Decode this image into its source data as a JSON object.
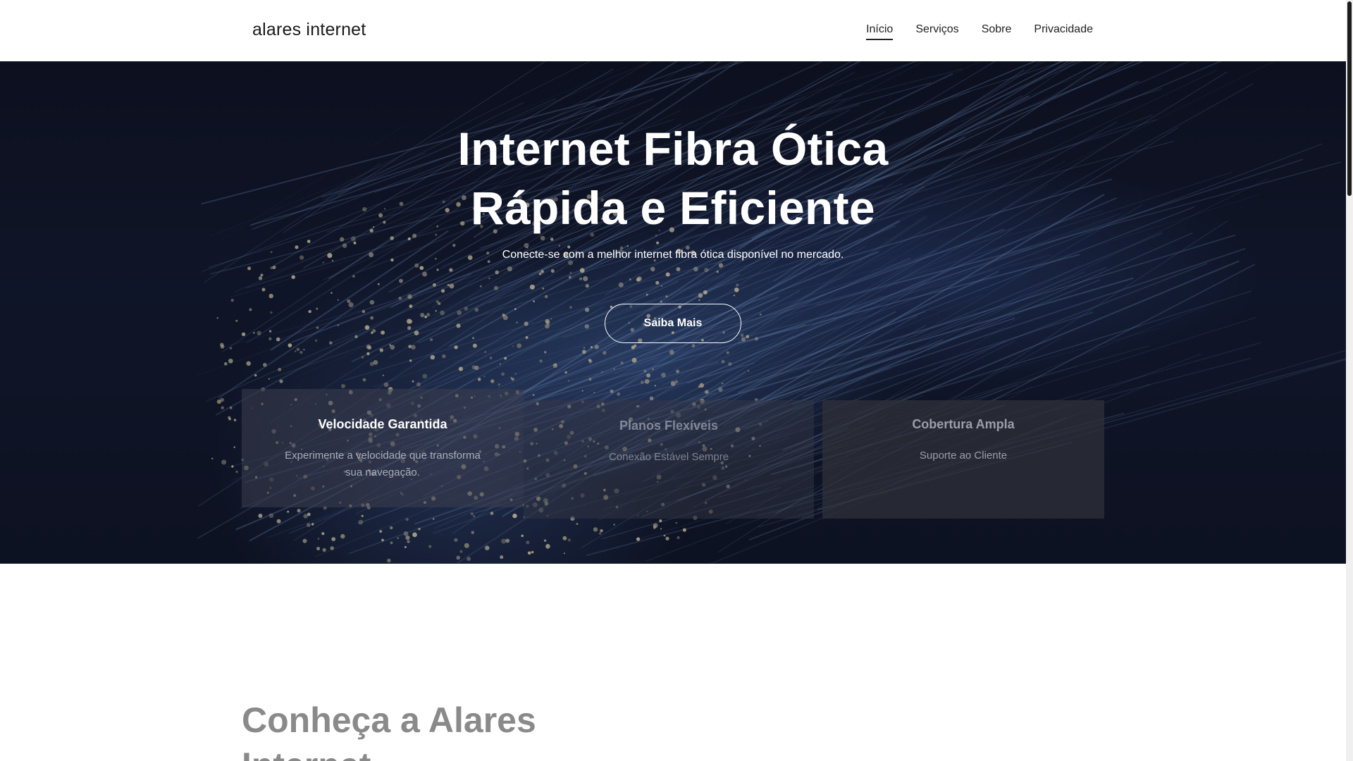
{
  "header": {
    "brand": "alares internet",
    "nav": [
      {
        "label": "Início",
        "active": true
      },
      {
        "label": "Serviços",
        "active": false
      },
      {
        "label": "Sobre",
        "active": false
      },
      {
        "label": "Privacidade",
        "active": false
      }
    ]
  },
  "hero": {
    "title_line1": "Internet Fibra Ótica",
    "title_line2": "Rápida e Eficiente",
    "subtitle": "Conecte-se com a melhor internet fibra ótica disponível no mercado.",
    "cta_label": "Saiba Mais",
    "background_icon": "fiber-optic-image"
  },
  "features": [
    {
      "title": "Velocidade Garantida",
      "text": "Experimente a velocidade que transforma sua navegação."
    },
    {
      "title": "Planos Flexíveis",
      "text": "Conexão Estável Sempre"
    },
    {
      "title": "Cobertura Ampla",
      "text": "Suporte ao Cliente"
    }
  ],
  "about": {
    "title_line1": "Conheça a Alares",
    "title_line2": "Internet"
  },
  "colors": {
    "hero_background": "#131a30",
    "fiber_highlight": "#e8dcb8",
    "fiber_strand": "#7fa3d8",
    "text_dark": "#222222",
    "about_title": "#8a8a8a"
  }
}
